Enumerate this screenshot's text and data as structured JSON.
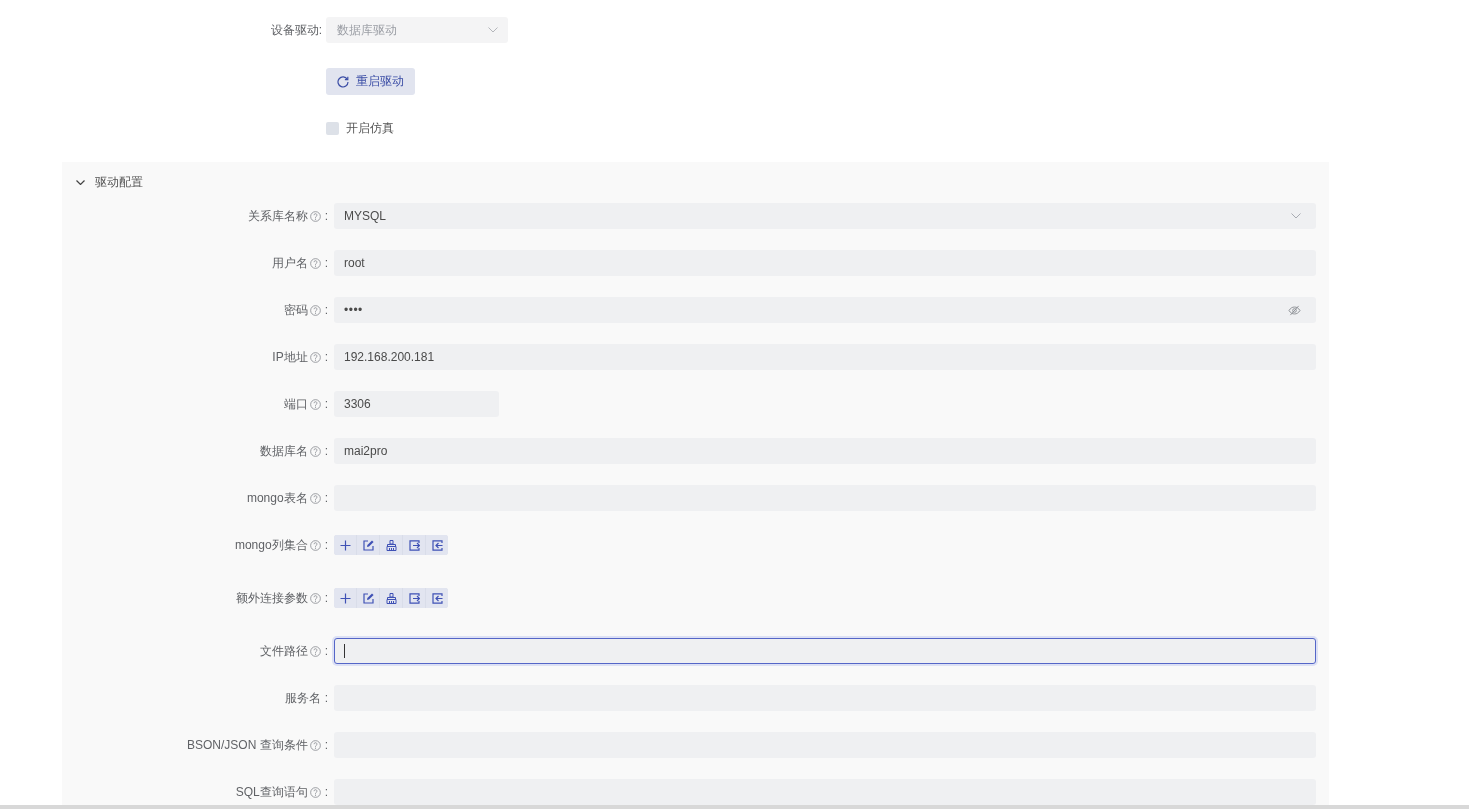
{
  "device_driver": {
    "label": "设备驱动:",
    "value": "数据库驱动",
    "disabled": true
  },
  "restart_button": {
    "label": "重启驱动"
  },
  "simulation": {
    "label": "开启仿真",
    "checked": false
  },
  "driver_config": {
    "title": "驱动配置",
    "expanded": true,
    "fields": [
      {
        "label": "关系库名称",
        "help": true,
        "colon": ":",
        "kind": "select",
        "value": "MYSQL",
        "focused": false
      },
      {
        "label": "用户名",
        "help": true,
        "colon": ":",
        "kind": "text",
        "value": "root",
        "focused": false
      },
      {
        "label": "密码",
        "help": true,
        "colon": ":",
        "kind": "password",
        "value": "••••",
        "focused": false
      },
      {
        "label": "IP地址",
        "help": true,
        "colon": ":",
        "kind": "text",
        "value": "192.168.200.181",
        "focused": false
      },
      {
        "label": "端口",
        "help": true,
        "colon": ":",
        "kind": "number",
        "value": "3306",
        "focused": false
      },
      {
        "label": "数据库名",
        "help": true,
        "colon": ":",
        "kind": "text",
        "value": "mai2pro",
        "focused": false
      },
      {
        "label": "mongo表名",
        "help": true,
        "colon": ":",
        "kind": "text",
        "focused": false
      },
      {
        "label": "mongo列集合",
        "help": true,
        "colon": ":",
        "kind": "toolbar",
        "focused": false
      },
      {
        "label": "额外连接参数",
        "help": true,
        "colon": ":",
        "kind": "toolbar",
        "focused": false
      },
      {
        "label": "文件路径",
        "help": true,
        "colon": ":",
        "kind": "text",
        "focused": true
      },
      {
        "label": "服务名",
        "help": false,
        "colon": ":",
        "kind": "text",
        "focused": false
      },
      {
        "label": "BSON/JSON 查询条件",
        "help": true,
        "colon": ":",
        "kind": "text",
        "focused": false
      },
      {
        "label": "SQL查询语句",
        "help": true,
        "colon": ":",
        "kind": "text",
        "focused": false
      }
    ]
  }
}
